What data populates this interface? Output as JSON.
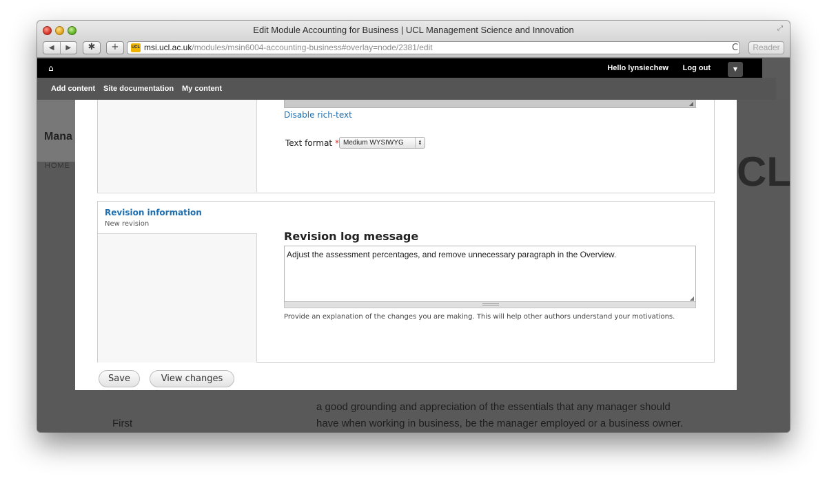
{
  "window": {
    "title": "Edit Module Accounting for Business | UCL Management Science and Innovation"
  },
  "browser": {
    "back": "◀",
    "forward": "▶",
    "topsites": "✱",
    "add": "+",
    "favicon_text": "UCL",
    "url_host": "msi.ucl.ac.uk",
    "url_path": "/modules/msin6004-accounting-business#overlay=node/2381/edit",
    "reload": "C",
    "reader": "Reader"
  },
  "toolbar": {
    "home_icon": "⌂",
    "hello": "Hello lynsiechew",
    "logout": "Log out",
    "toggle": "▼"
  },
  "shortcuts": {
    "add_content": "Add content",
    "site_docs": "Site documentation",
    "my_content": "My content"
  },
  "background": {
    "mana": "Mana",
    "home": "HOME",
    "cl": "CL",
    "first": "First",
    "text1": "a good grounding and appreciation of the essentials that any manager should",
    "text2": "have when working in business, be the manager employed or a business owner."
  },
  "editor": {
    "disable_rich": "Disable rich-text",
    "text_format_label": "Text format",
    "required_mark": "*",
    "text_format_value": "Medium WYSIWYG",
    "select_arrows": "⇕"
  },
  "revision": {
    "title": "Revision information",
    "subtitle": "New revision",
    "log_label": "Revision log message",
    "log_value": "Adjust the assessment percentages, and remove unnecessary paragraph in the Overview.",
    "help": "Provide an explanation of the changes you are making. This will help other authors understand your motivations."
  },
  "actions": {
    "save": "Save",
    "view_changes": "View changes"
  }
}
